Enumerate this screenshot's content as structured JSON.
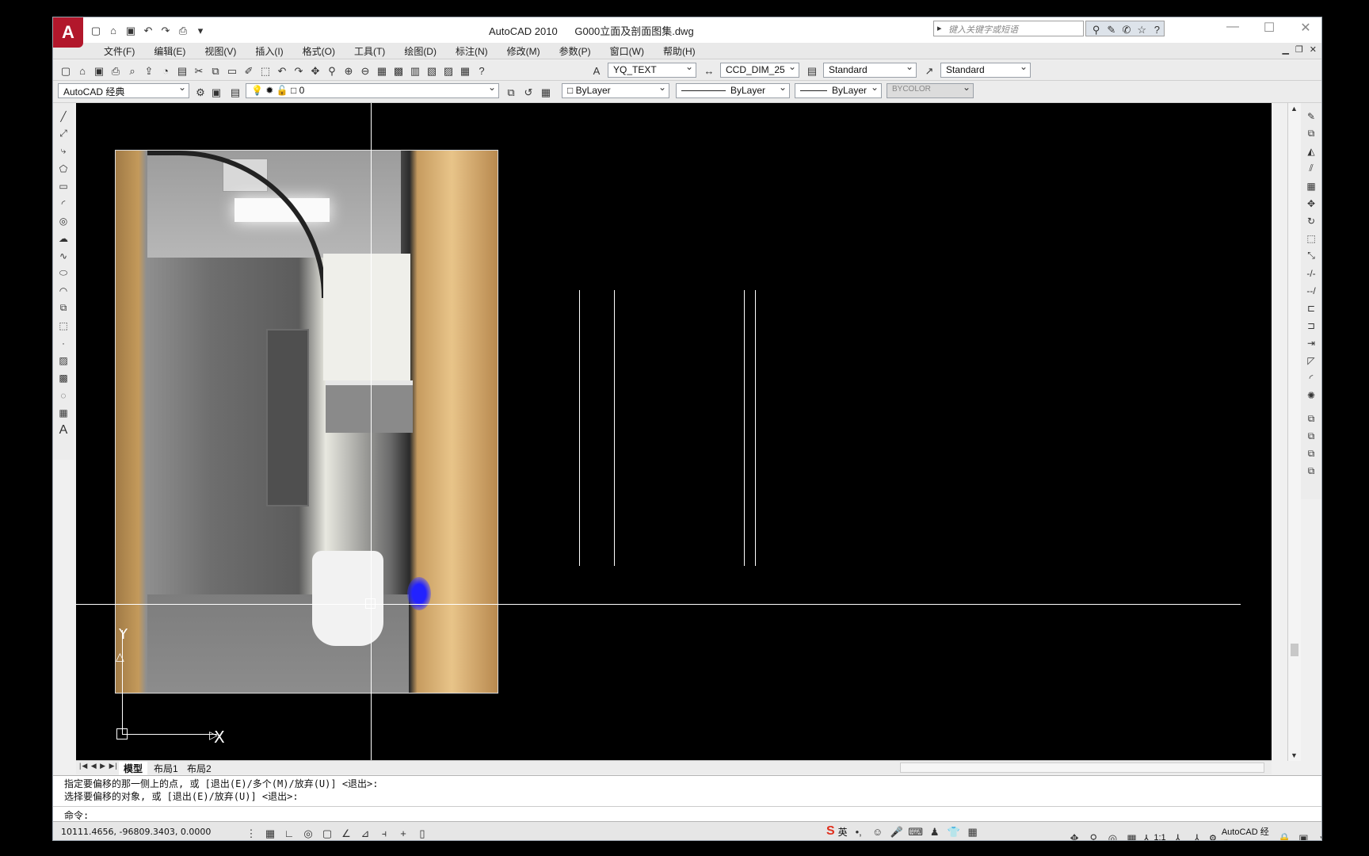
{
  "window": {
    "app_name": "AutoCAD 2010",
    "file_name": "G000立面及剖面图集.dwg",
    "search_placeholder": "键入关键字或短语"
  },
  "menu": [
    "文件(F)",
    "编辑(E)",
    "视图(V)",
    "插入(I)",
    "格式(O)",
    "工具(T)",
    "绘图(D)",
    "标注(N)",
    "修改(M)",
    "参数(P)",
    "窗口(W)",
    "帮助(H)"
  ],
  "toolbar1": {
    "text_style": "YQ_TEXT",
    "dim_style": "CCD_DIM_25",
    "table_style": "Standard",
    "multileader_style": "Standard"
  },
  "toolbar2": {
    "workspace": "AutoCAD 经典",
    "layer": "0",
    "color": "ByLayer",
    "linetype": "ByLayer",
    "lineweight": "ByLayer",
    "plotstyle": "BYCOLOR"
  },
  "ucs": {
    "x_label": "X",
    "y_label": "Y"
  },
  "tabs": [
    "模型",
    "布局1",
    "布局2"
  ],
  "command": {
    "history_1": "指定要偏移的那一侧上的点, 或 [退出(E)/多个(M)/放弃(U)] <退出>:",
    "history_2": "选择要偏移的对象, 或 [退出(E)/放弃(U)] <退出>:",
    "prompt": "命令:"
  },
  "status": {
    "coords": "10111.4656, -96809.3403, 0.0000",
    "ime_lang": "英",
    "scale": "1:1",
    "workspace": "AutoCAD 经典"
  },
  "colors": {
    "canvas": "#000000",
    "logo": "#b2172b",
    "chrome": "#ececec"
  }
}
